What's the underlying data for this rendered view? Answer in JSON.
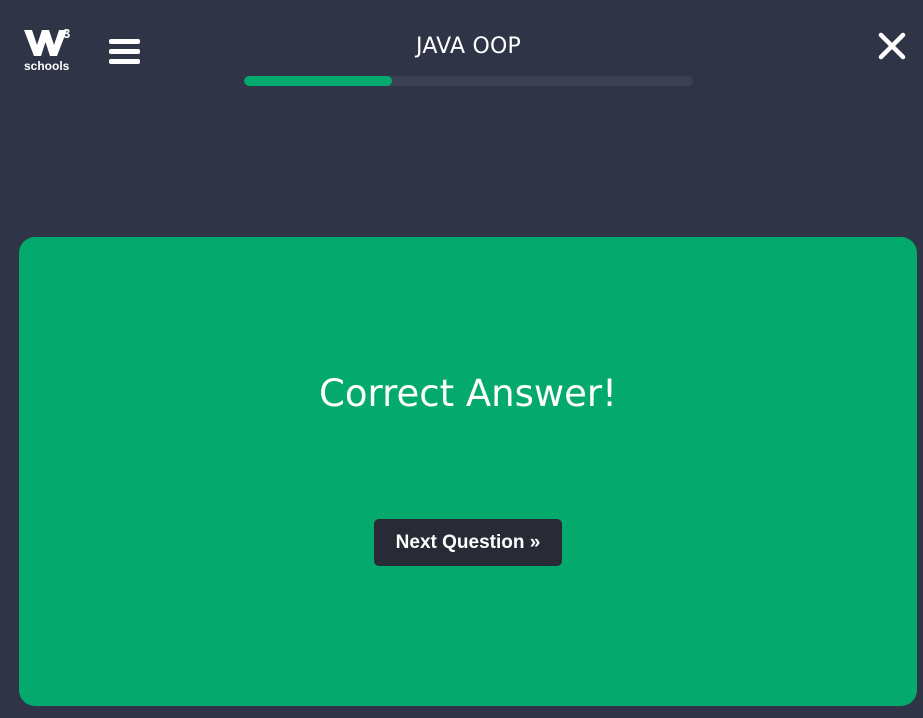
{
  "header": {
    "logo": {
      "superscript": "3",
      "text": "schools",
      "icon": "w3schools-logo"
    },
    "menu": {
      "icon": "hamburger-menu-icon"
    },
    "title": "JAVA OOP",
    "progress": {
      "fraction": 0.33,
      "fill_color": "#04aa6d"
    },
    "close": {
      "icon": "close-icon"
    }
  },
  "result": {
    "message": "Correct Answer!",
    "background_color": "#04aa6d",
    "next_button_label": "Next Question »"
  },
  "colors": {
    "page_background": "#2f3546",
    "button_background": "#282a35",
    "text": "#ffffff"
  }
}
